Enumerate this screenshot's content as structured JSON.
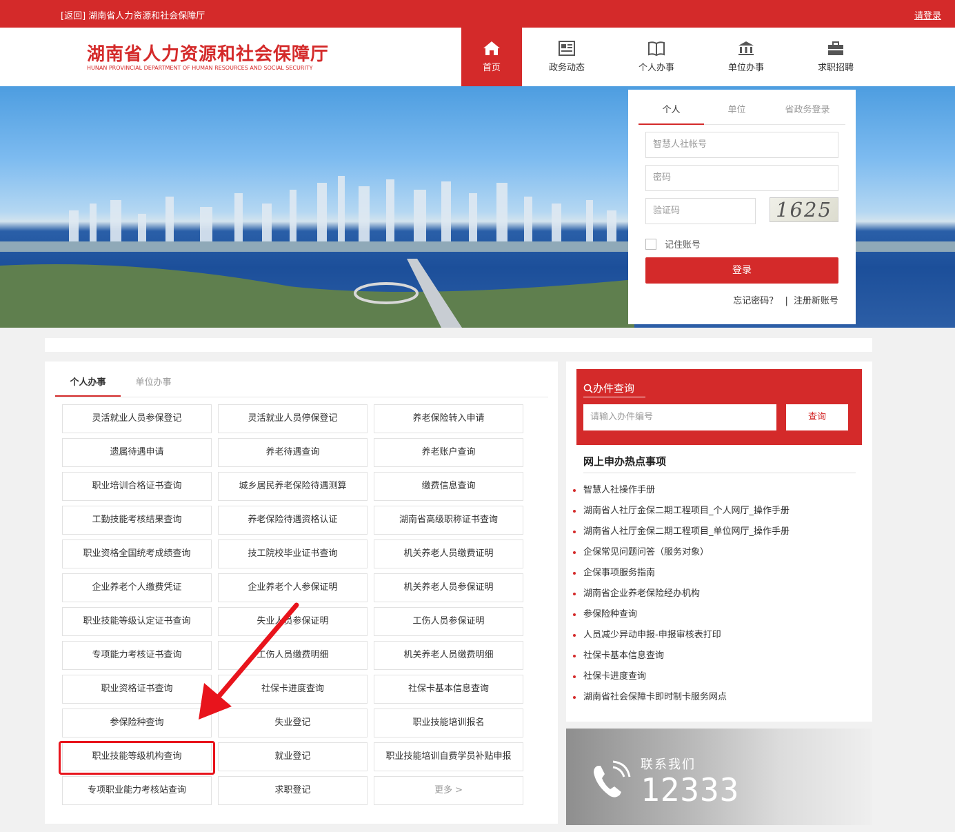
{
  "topbar": {
    "back_text": "[返回]  湖南省人力资源和社会保障厅",
    "login_link": "请登录"
  },
  "header": {
    "logo_cn": "湖南省人力资源和社会保障厅",
    "logo_en": "HUNAN PROVINCIAL DEPARTMENT OF HUMAN RESOURCES AND SOCIAL SECURITY",
    "nav": [
      {
        "label": "首页",
        "icon": "home-icon"
      },
      {
        "label": "政务动态",
        "icon": "news-icon"
      },
      {
        "label": "个人办事",
        "icon": "book-icon"
      },
      {
        "label": "单位办事",
        "icon": "bank-icon"
      },
      {
        "label": "求职招聘",
        "icon": "briefcase-icon"
      }
    ]
  },
  "login": {
    "tabs": [
      "个人",
      "单位",
      "省政务登录"
    ],
    "account_placeholder": "智慧人社帐号",
    "password_placeholder": "密码",
    "captcha_placeholder": "验证码",
    "captcha_text": "1625",
    "remember_label": "记住账号",
    "login_button": "登录",
    "forgot_link": "忘记密码？",
    "separator": "|",
    "register_link": "注册新账号"
  },
  "services": {
    "tabs": [
      "个人办事",
      "单位办事"
    ],
    "items": [
      "灵活就业人员参保登记",
      "灵活就业人员停保登记",
      "养老保险转入申请",
      "遗属待遇申请",
      "养老待遇查询",
      "养老账户查询",
      "职业培训合格证书查询",
      "城乡居民养老保险待遇测算",
      "缴费信息查询",
      "工勤技能考核结果查询",
      "养老保险待遇资格认证",
      "湖南省高级职称证书查询",
      "职业资格全国统考成绩查询",
      "技工院校毕业证书查询",
      "机关养老人员缴费证明",
      "企业养老个人缴费凭证",
      "企业养老个人参保证明",
      "机关养老人员参保证明",
      "职业技能等级认定证书查询",
      "失业人员参保证明",
      "工伤人员参保证明",
      "专项能力考核证书查询",
      "工伤人员缴费明细",
      "机关养老人员缴费明细",
      "职业资格证书查询",
      "社保卡进度查询",
      "社保卡基本信息查询",
      "参保险种查询",
      "失业登记",
      "职业技能培训报名",
      "职业技能等级机构查询",
      "就业登记",
      "职业技能培训自费学员补贴申报",
      "专项职业能力考核站查询",
      "求职登记",
      "更多 >"
    ]
  },
  "query": {
    "title": "办件查询",
    "input_placeholder": "请输入办件编号",
    "button": "查询"
  },
  "hot": {
    "title": "网上申办热点事项",
    "items": [
      "智慧人社操作手册",
      "湖南省人社厅金保二期工程项目_个人网厅_操作手册",
      "湖南省人社厅金保二期工程项目_单位网厅_操作手册",
      "企保常见问题问答（服务对象）",
      "企保事项服务指南",
      "湖南省企业养老保险经办机构",
      "参保险种查询",
      "人员减少异动申报-申报审核表打印",
      "社保卡基本信息查询",
      "社保卡进度查询",
      "湖南省社会保障卡即时制卡服务网点"
    ]
  },
  "contact": {
    "label": "联系我们",
    "phone": "12333"
  },
  "colors": {
    "brand_red": "#d42a2a",
    "annotation_red": "#e8141c"
  }
}
